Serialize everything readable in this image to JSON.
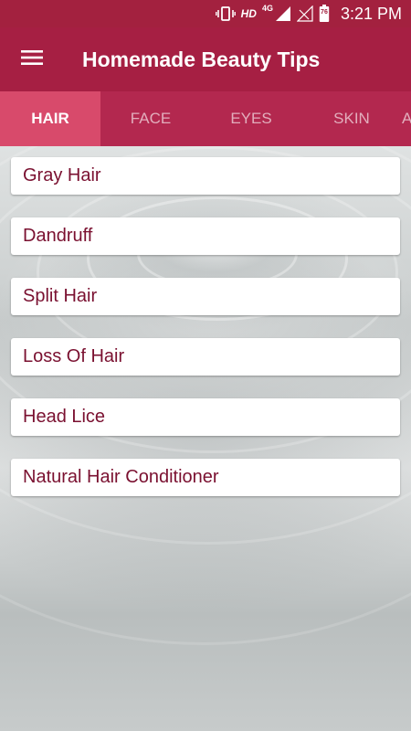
{
  "status_bar": {
    "hd": "HD",
    "network": "4G",
    "battery": "76",
    "time": "3:21 PM"
  },
  "app_bar": {
    "title": "Homemade Beauty Tips",
    "menu_icon": "hamburger-menu-icon"
  },
  "tabs": [
    {
      "label": "HAIR",
      "active": true
    },
    {
      "label": "FACE",
      "active": false
    },
    {
      "label": "EYES",
      "active": false
    },
    {
      "label": "SKIN",
      "active": false
    },
    {
      "label": "A",
      "active": false
    }
  ],
  "list": {
    "items": [
      "Gray Hair",
      "Dandruff",
      "Split Hair",
      "Loss Of Hair",
      "Head Lice",
      "Natural Hair Conditioner"
    ]
  },
  "colors": {
    "status_bar": "#a3213f",
    "app_bar": "#a61f43",
    "tab_bar": "#b3284f",
    "tab_active": "#d84a6b",
    "item_text": "#7a1030"
  }
}
